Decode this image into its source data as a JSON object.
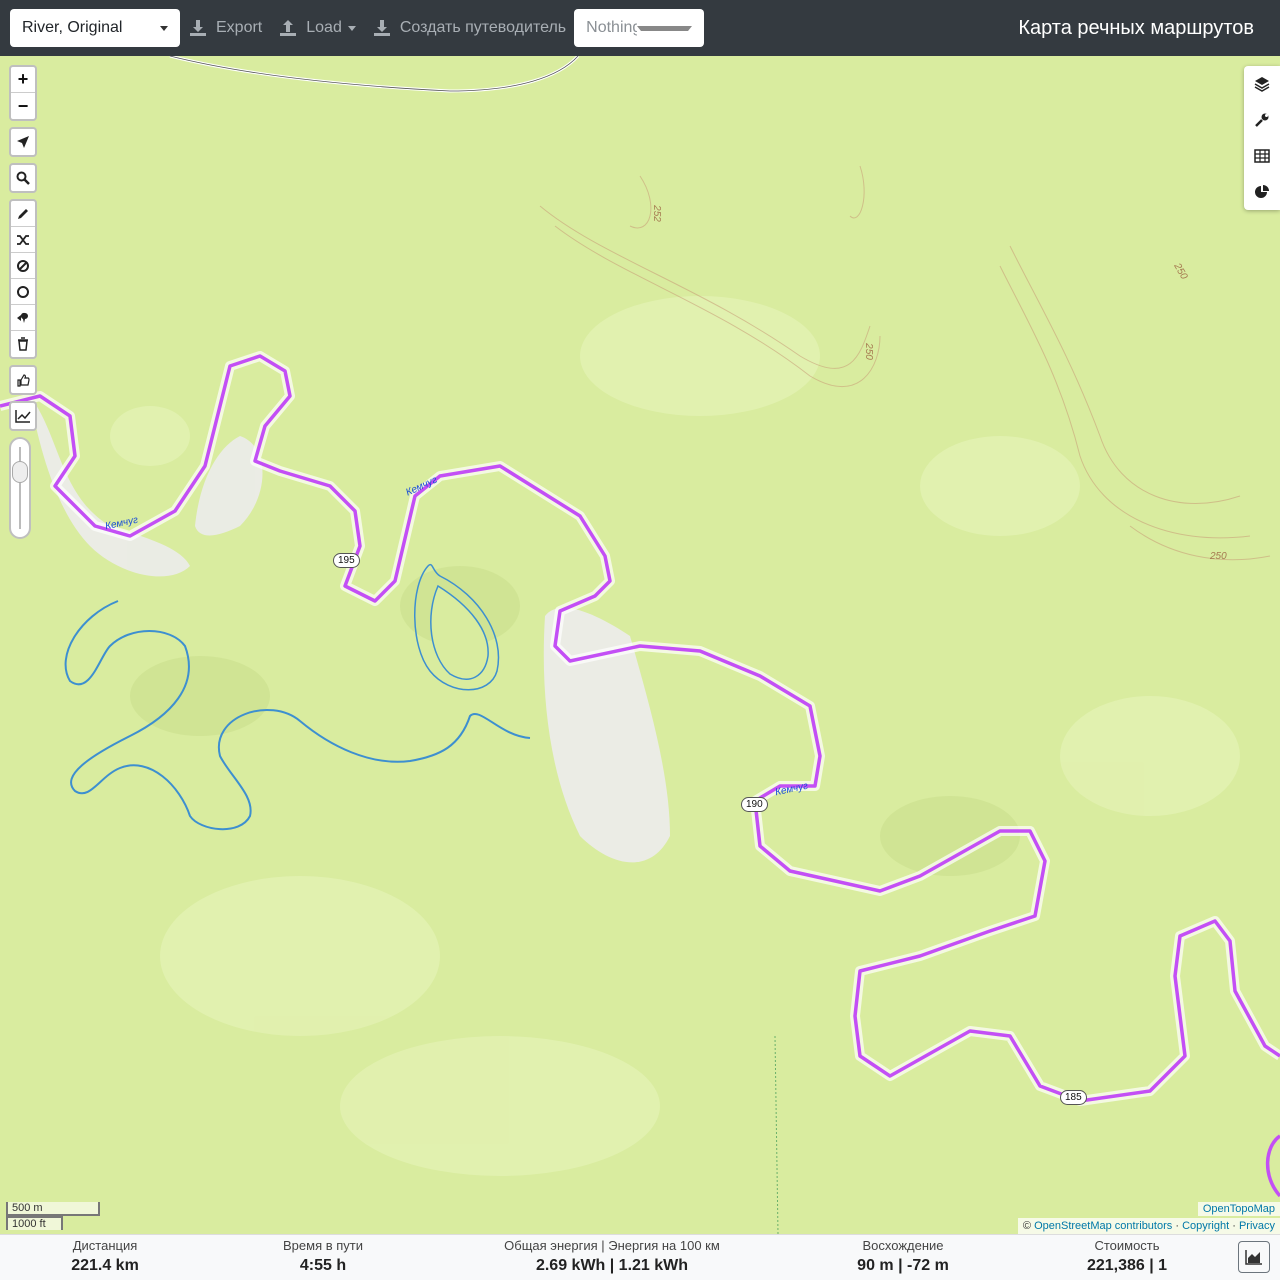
{
  "navbar": {
    "profile": "River, Original",
    "export_label": "Export",
    "load_label": "Load",
    "guide_label": "Создать путеводитель",
    "nothing_selected": "Nothing selected",
    "brand": "Карта речных маршрутов"
  },
  "map": {
    "river_name": "Кемчуг",
    "markers": [
      "195",
      "190",
      "185"
    ],
    "contours": [
      "252",
      "250",
      "250",
      "250"
    ],
    "scale_metric": "500 m",
    "scale_imperial": "1000 ft",
    "attribution_top": "OpenTopoMap",
    "attribution_prefix": "©",
    "attribution_osm": "OpenStreetMap contributors",
    "attribution_sep": "·",
    "attribution_copyright": "Copyright",
    "attribution_privacy": "Privacy",
    "route_color": "#c34ff5",
    "water_color": "#a7d5f0"
  },
  "left_controls": {
    "zoom_in": "+",
    "zoom_out": "−"
  },
  "stats": {
    "distance_label": "Дистанция",
    "distance_value": "221.4 km",
    "time_label": "Время в пути",
    "time_value": "4:55 h",
    "energy_label": "Общая энергия | Энергия на 100 км",
    "energy_value": "2.69 kWh | 1.21 kWh",
    "ascent_label": "Восхождение",
    "ascent_value": "90 m | -72 m",
    "cost_label": "Стоимость",
    "cost_value": "221,386 | 1"
  }
}
